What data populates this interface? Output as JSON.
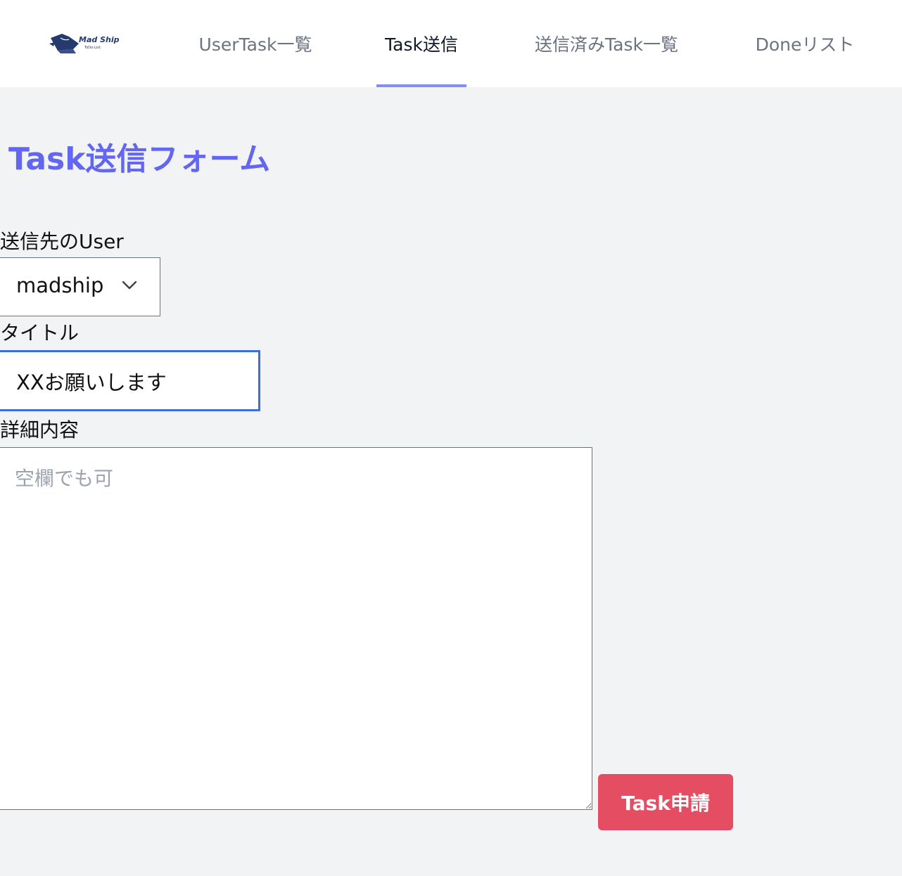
{
  "nav": {
    "logo": {
      "name": "Mad Ship",
      "tagline": "ToDo-List"
    },
    "items": [
      {
        "label": "UserTask一覧"
      },
      {
        "label": "Task送信"
      },
      {
        "label": "送信済みTask一覧"
      },
      {
        "label": "Doneリスト"
      }
    ],
    "active_index": 1,
    "active_indicator_color": "#818cf8"
  },
  "form": {
    "title": "Task送信フォーム",
    "user_field": {
      "label": "送信先のUser",
      "selected": "madship",
      "icon": "chevron-down-icon"
    },
    "title_field": {
      "label": "タイトル",
      "value": "XXお願いします"
    },
    "detail_field": {
      "label": "詳細内容",
      "placeholder": "空欄でも可",
      "value": ""
    },
    "submit_label": "Task申請"
  },
  "colors": {
    "title": "#6366f1",
    "submit": "#e54d62",
    "focus_border": "#3b6fe0",
    "background": "#f2f3f5"
  }
}
